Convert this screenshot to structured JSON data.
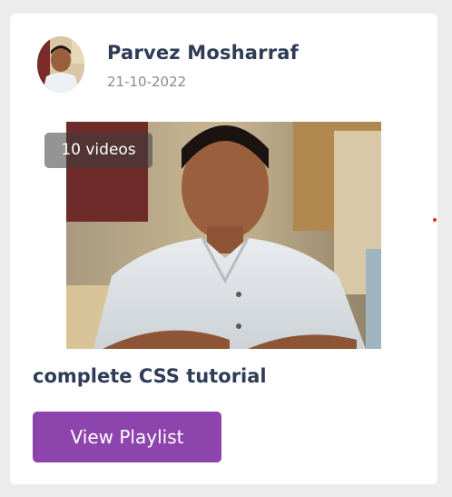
{
  "card": {
    "author": {
      "name": "Parvez Mosharraf",
      "date": "21-10-2022"
    },
    "thumbnail": {
      "video_count": "10 videos"
    },
    "title": "complete CSS tutorial",
    "button_label": "View Playlist"
  },
  "colors": {
    "page_background": "#ececec",
    "card_background": "#ffffff",
    "heading_text": "#2f3c55",
    "muted_text": "#8a8a8a",
    "button_background": "#8e44ad",
    "button_text": "#ffffff"
  }
}
